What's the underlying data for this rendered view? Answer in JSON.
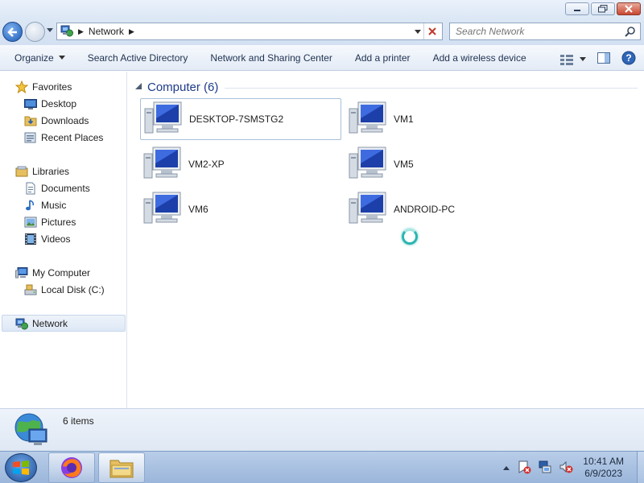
{
  "address": {
    "crumbs": [
      "Network"
    ],
    "search_placeholder": "Search Network"
  },
  "toolbar": {
    "organize": "Organize",
    "search_ad": "Search Active Directory",
    "network_sharing": "Network and Sharing Center",
    "add_printer": "Add a printer",
    "add_wireless": "Add a wireless device"
  },
  "sidebar": {
    "favorites": "Favorites",
    "desktop": "Desktop",
    "downloads": "Downloads",
    "recent_places": "Recent Places",
    "libraries": "Libraries",
    "documents": "Documents",
    "music": "Music",
    "pictures": "Pictures",
    "videos": "Videos",
    "my_computer": "My Computer",
    "local_disk": "Local Disk (C:)",
    "network": "Network"
  },
  "content": {
    "group_label": "Computer (6)",
    "computers": [
      "DESKTOP-7SMSTG2",
      "VM1",
      "VM2-XP",
      "VM5",
      "VM6",
      "ANDROID-PC"
    ]
  },
  "details": {
    "count": "6 items"
  },
  "taskbar": {
    "time": "10:41 AM",
    "date": "6/9/2023"
  }
}
